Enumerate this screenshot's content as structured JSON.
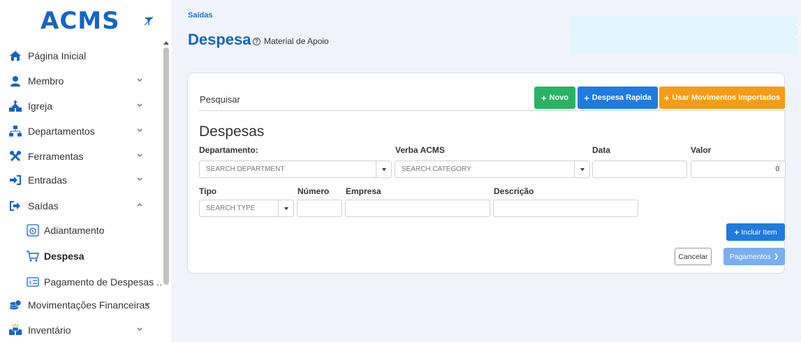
{
  "app": {
    "logo": "ACMS"
  },
  "sidebar": {
    "items": [
      {
        "label": "Página Inicial",
        "icon": "home-icon"
      },
      {
        "label": "Membro",
        "icon": "user-icon"
      },
      {
        "label": "Igreja",
        "icon": "church-icon"
      },
      {
        "label": "Departamentos",
        "icon": "sitemap-icon"
      },
      {
        "label": "Ferramentas",
        "icon": "tools-icon"
      },
      {
        "label": "Entradas",
        "icon": "sign-in-icon"
      },
      {
        "label": "Saídas",
        "icon": "sign-out-icon"
      },
      {
        "label": "Movimentações Financeiras",
        "icon": "coins-icon"
      },
      {
        "label": "Inventário",
        "icon": "boxes-icon"
      }
    ],
    "sub_items": [
      {
        "label": "Adiantamento",
        "icon": "advance-icon"
      },
      {
        "label": "Despesa",
        "icon": "cart-icon"
      },
      {
        "label": "Pagamento de Despesas ...",
        "icon": "receipt-icon"
      }
    ]
  },
  "header": {
    "breadcrumb": "Saídas",
    "title": "Despesa",
    "help_label": "Material de Apoio",
    "help_symbol": "?"
  },
  "card": {
    "search_tab": "Pesquisar",
    "buttons": {
      "plus": "+",
      "novo": "Novo",
      "rapida": "Despesa Rapida",
      "import": "Usar Movimentos Importados"
    },
    "section_title": "Despesas",
    "fields": {
      "departamento_label": "Departamento:",
      "departamento_placeholder": "SEARCH DEPARTMENT",
      "verba_label": "Verba ACMS",
      "verba_placeholder": "SEARCH CATEGORY",
      "data_label": "Data",
      "data_value": "",
      "valor_label": "Valor",
      "valor_value": "0",
      "tipo_label": "Tipo",
      "tipo_placeholder": "SEARCH TYPE",
      "numero_label": "Número",
      "numero_value": "",
      "empresa_label": "Empresa",
      "empresa_value": "",
      "descricao_label": "Descrição",
      "descricao_value": ""
    },
    "actions": {
      "incluir": "Incluir Item",
      "cancelar": "Cancelar",
      "pagamentos": "Pagamentos",
      "pagamentos_arrow": "❯"
    }
  },
  "colors": {
    "primary": "#1565c0",
    "green": "#28b463",
    "blue": "#1e7be0",
    "orange": "#f59c17",
    "light_blue": "#79aef0",
    "notice_bg": "#e0f5fd"
  }
}
